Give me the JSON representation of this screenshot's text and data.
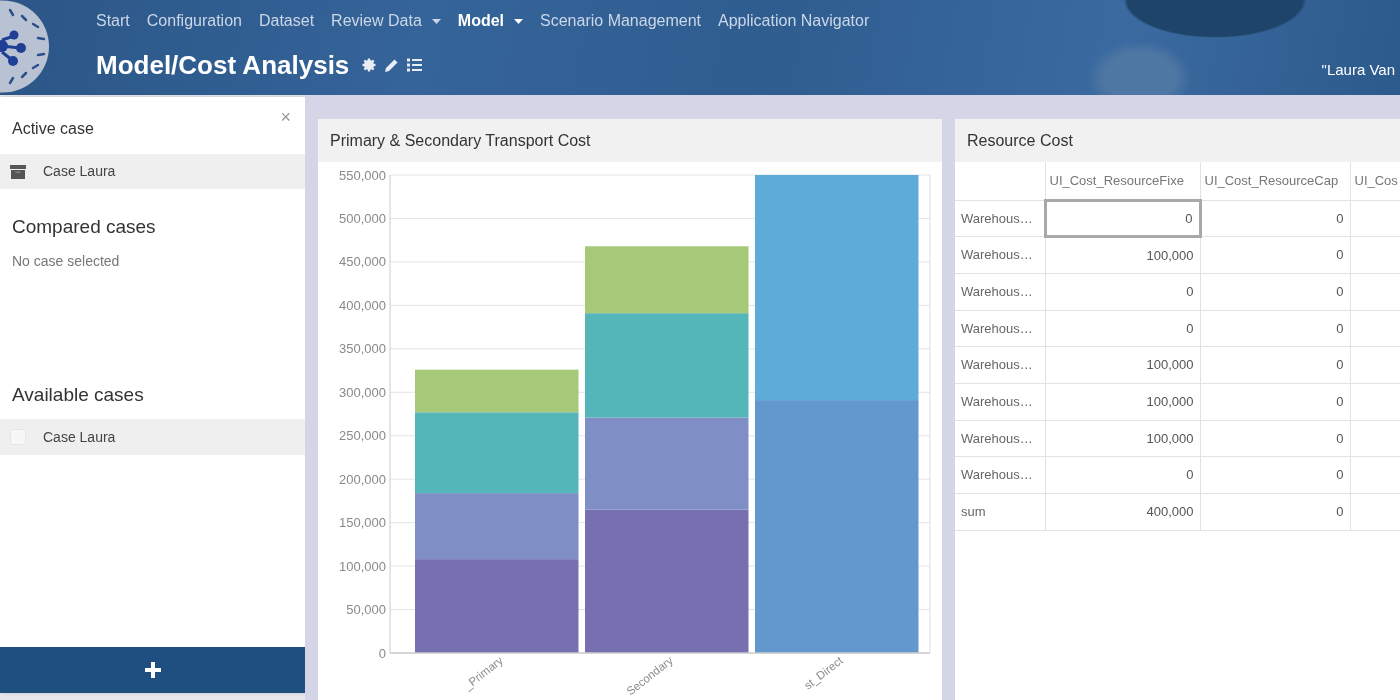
{
  "header": {
    "nav": [
      {
        "label": "Start",
        "selected": false,
        "has_menu": false
      },
      {
        "label": "Configuration",
        "selected": false,
        "has_menu": false
      },
      {
        "label": "Dataset",
        "selected": false,
        "has_menu": false
      },
      {
        "label": "Review Data",
        "selected": false,
        "has_menu": true
      },
      {
        "label": "Model",
        "selected": true,
        "has_menu": true
      },
      {
        "label": "Scenario Management",
        "selected": false,
        "has_menu": false
      },
      {
        "label": "Application Navigator",
        "selected": false,
        "has_menu": false
      }
    ],
    "title": "Model/Cost Analysis",
    "user": "\"Laura Van"
  },
  "sidebar": {
    "close": "×",
    "active_case": {
      "title": "Active case",
      "case": "Case Laura"
    },
    "compared_cases": {
      "title": "Compared cases",
      "empty_text": "No case selected"
    },
    "available_cases": {
      "title": "Available cases",
      "items": [
        {
          "label": "Case Laura",
          "checked": false
        }
      ]
    }
  },
  "chart_panel": {
    "title": "Primary & Secondary Transport Cost",
    "chart_data": {
      "type": "bar",
      "categories": [
        "_Primary",
        "Secondary",
        "st_Direct"
      ],
      "series": [
        {
          "color": "#7670b0",
          "values": [
            108000,
            165000,
            null
          ]
        },
        {
          "color": "#7f8fc5",
          "values": [
            76000,
            106000,
            null
          ]
        },
        {
          "color": "#54b6b9",
          "values": [
            93000,
            120000,
            null
          ]
        },
        {
          "color": "#a5c879",
          "values": [
            49000,
            77000,
            null
          ]
        },
        {
          "color": "#6298ce",
          "values": [
            null,
            null,
            291000
          ]
        },
        {
          "color": "#5eaad9",
          "values": [
            null,
            null,
            259000
          ]
        }
      ],
      "ylim": [
        0,
        550000
      ],
      "yticks": [
        {
          "value": 0,
          "label": "0"
        },
        {
          "value": 50000,
          "label": "50,000"
        },
        {
          "value": 100000,
          "label": "100,000"
        },
        {
          "value": 150000,
          "label": "150,000"
        },
        {
          "value": 200000,
          "label": "200,000"
        },
        {
          "value": 250000,
          "label": "250,000"
        },
        {
          "value": 300000,
          "label": "300,000"
        },
        {
          "value": 350000,
          "label": "350,000"
        },
        {
          "value": 400000,
          "label": "400,000"
        },
        {
          "value": 450000,
          "label": "450,000"
        },
        {
          "value": 500000,
          "label": "500,000"
        },
        {
          "value": 550000,
          "label": "550,000"
        }
      ],
      "stacked": true,
      "grid": true
    }
  },
  "table_panel": {
    "title": "Resource Cost",
    "columns": [
      "UI_Cost_ResourceFixe",
      "UI_Cost_ResourceCap",
      "UI_Cos"
    ],
    "rows": [
      {
        "label": "Warehous…",
        "cells": [
          {
            "text": "0",
            "selected": true
          },
          {
            "text": "0",
            "selected": false
          }
        ]
      },
      {
        "label": "Warehous…",
        "cells": [
          {
            "text": "100,000",
            "selected": false
          },
          {
            "text": "0",
            "selected": false
          }
        ]
      },
      {
        "label": "Warehous…",
        "cells": [
          {
            "text": "0",
            "selected": false
          },
          {
            "text": "0",
            "selected": false
          }
        ]
      },
      {
        "label": "Warehous…",
        "cells": [
          {
            "text": "0",
            "selected": false
          },
          {
            "text": "0",
            "selected": false
          }
        ]
      },
      {
        "label": "Warehous…",
        "cells": [
          {
            "text": "100,000",
            "selected": false
          },
          {
            "text": "0",
            "selected": false
          }
        ]
      },
      {
        "label": "Warehous…",
        "cells": [
          {
            "text": "100,000",
            "selected": false
          },
          {
            "text": "0",
            "selected": false
          }
        ]
      },
      {
        "label": "Warehous…",
        "cells": [
          {
            "text": "100,000",
            "selected": false
          },
          {
            "text": "0",
            "selected": false
          }
        ]
      },
      {
        "label": "Warehous…",
        "cells": [
          {
            "text": "0",
            "selected": false
          },
          {
            "text": "0",
            "selected": false
          }
        ]
      },
      {
        "label": "sum",
        "cells": [
          {
            "text": "400,000",
            "selected": false
          },
          {
            "text": "0",
            "selected": false
          }
        ]
      }
    ]
  }
}
